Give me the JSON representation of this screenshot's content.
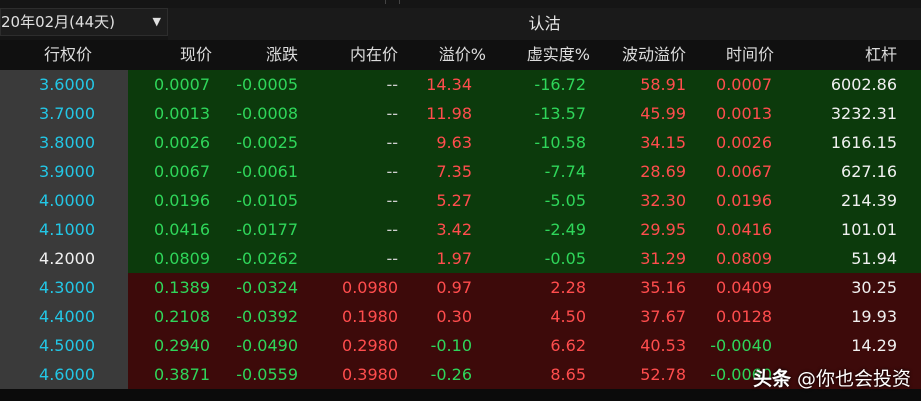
{
  "toolbar": {
    "expiry_select": "20年02月(44天)",
    "call_section": "认沽"
  },
  "columns": [
    "行权价",
    "现价",
    "涨跌",
    "内在价",
    "溢价%",
    "虚实度%",
    "波动溢价",
    "时间价",
    "杠杆"
  ],
  "rows": [
    {
      "strike": "3.6000",
      "price": "0.0007",
      "change": "-0.0005",
      "intrinsic": "--",
      "premium": "14.34",
      "moneyness": "-16.72",
      "volatility": "58.91",
      "time_value": "0.0007",
      "leverage": "6002.86"
    },
    {
      "strike": "3.7000",
      "price": "0.0013",
      "change": "-0.0008",
      "intrinsic": "--",
      "premium": "11.98",
      "moneyness": "-13.57",
      "volatility": "45.99",
      "time_value": "0.0013",
      "leverage": "3232.31"
    },
    {
      "strike": "3.8000",
      "price": "0.0026",
      "change": "-0.0025",
      "intrinsic": "--",
      "premium": "9.63",
      "moneyness": "-10.58",
      "volatility": "34.15",
      "time_value": "0.0026",
      "leverage": "1616.15"
    },
    {
      "strike": "3.9000",
      "price": "0.0067",
      "change": "-0.0061",
      "intrinsic": "--",
      "premium": "7.35",
      "moneyness": "-7.74",
      "volatility": "28.69",
      "time_value": "0.0067",
      "leverage": "627.16"
    },
    {
      "strike": "4.0000",
      "price": "0.0196",
      "change": "-0.0105",
      "intrinsic": "--",
      "premium": "5.27",
      "moneyness": "-5.05",
      "volatility": "32.30",
      "time_value": "0.0196",
      "leverage": "214.39"
    },
    {
      "strike": "4.1000",
      "price": "0.0416",
      "change": "-0.0177",
      "intrinsic": "--",
      "premium": "3.42",
      "moneyness": "-2.49",
      "volatility": "29.95",
      "time_value": "0.0416",
      "leverage": "101.01"
    },
    {
      "strike": "4.2000",
      "price": "0.0809",
      "change": "-0.0262",
      "intrinsic": "--",
      "premium": "1.97",
      "moneyness": "-0.05",
      "volatility": "31.29",
      "time_value": "0.0809",
      "leverage": "51.94"
    },
    {
      "strike": "4.3000",
      "price": "0.1389",
      "change": "-0.0324",
      "intrinsic": "0.0980",
      "premium": "0.97",
      "moneyness": "2.28",
      "volatility": "35.16",
      "time_value": "0.0409",
      "leverage": "30.25"
    },
    {
      "strike": "4.4000",
      "price": "0.2108",
      "change": "-0.0392",
      "intrinsic": "0.1980",
      "premium": "0.30",
      "moneyness": "4.50",
      "volatility": "37.67",
      "time_value": "0.0128",
      "leverage": "19.93"
    },
    {
      "strike": "4.5000",
      "price": "0.2940",
      "change": "-0.0490",
      "intrinsic": "0.2980",
      "premium": "-0.10",
      "moneyness": "6.62",
      "volatility": "40.53",
      "time_value": "-0.0040",
      "leverage": "14.29"
    },
    {
      "strike": "4.6000",
      "price": "0.3871",
      "change": "-0.0559",
      "intrinsic": "0.3980",
      "premium": "-0.26",
      "moneyness": "8.65",
      "volatility": "52.78",
      "time_value": "-0.0060",
      "leverage": ""
    }
  ],
  "watermark": {
    "logo": "头条",
    "text": "@你也会投资"
  },
  "colors": {
    "strike_text": "#23c7e6",
    "atm_strike_text": "#f0f0f0",
    "up": "#ff4d4d",
    "down": "#2fd65a",
    "out_of_money_bg": "#0c3a0c",
    "in_the_money_bg": "#3d0a0a"
  },
  "highlight": {
    "atm_row": "4.2000"
  }
}
